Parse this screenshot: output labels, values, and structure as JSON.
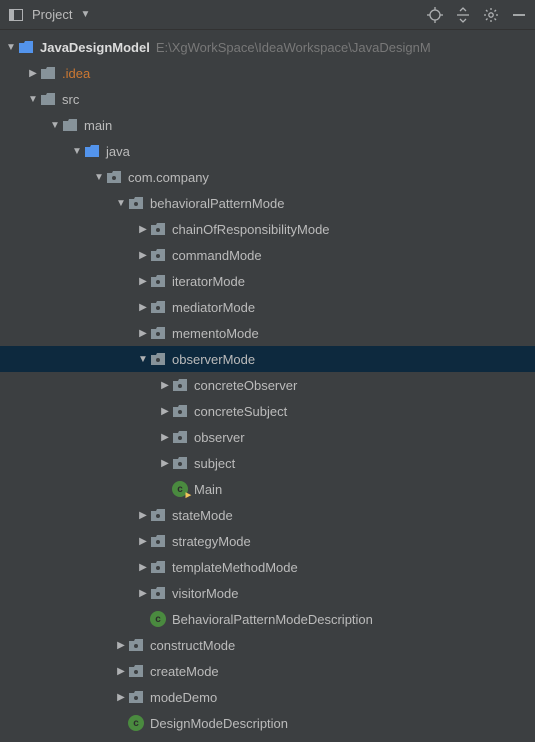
{
  "toolbar": {
    "title": "Project"
  },
  "root": {
    "label": "JavaDesignModel",
    "path": "E:\\XgWorkSpace\\IdeaWorkspace\\JavaDesignM"
  },
  "nodes": {
    "idea": ".idea",
    "src": "src",
    "main": "main",
    "java": "java",
    "company": "com.company",
    "behavioral": "behavioralPatternMode",
    "chain": "chainOfResponsibilityMode",
    "command": "commandMode",
    "iterator": "iteratorMode",
    "mediator": "mediatorMode",
    "memento": "mementoMode",
    "observer": "observerMode",
    "concreteObserver": "concreteObserver",
    "concreteSubject": "concreteSubject",
    "observerPkg": "observer",
    "subject": "subject",
    "mainClass": "Main",
    "state": "stateMode",
    "strategy": "strategyMode",
    "template": "templateMethodMode",
    "visitor": "visitorMode",
    "behavioralDesc": "BehavioralPatternModeDescription",
    "construct": "constructMode",
    "create": "createMode",
    "modeDemo": "modeDemo",
    "designDesc": "DesignModeDescription"
  }
}
